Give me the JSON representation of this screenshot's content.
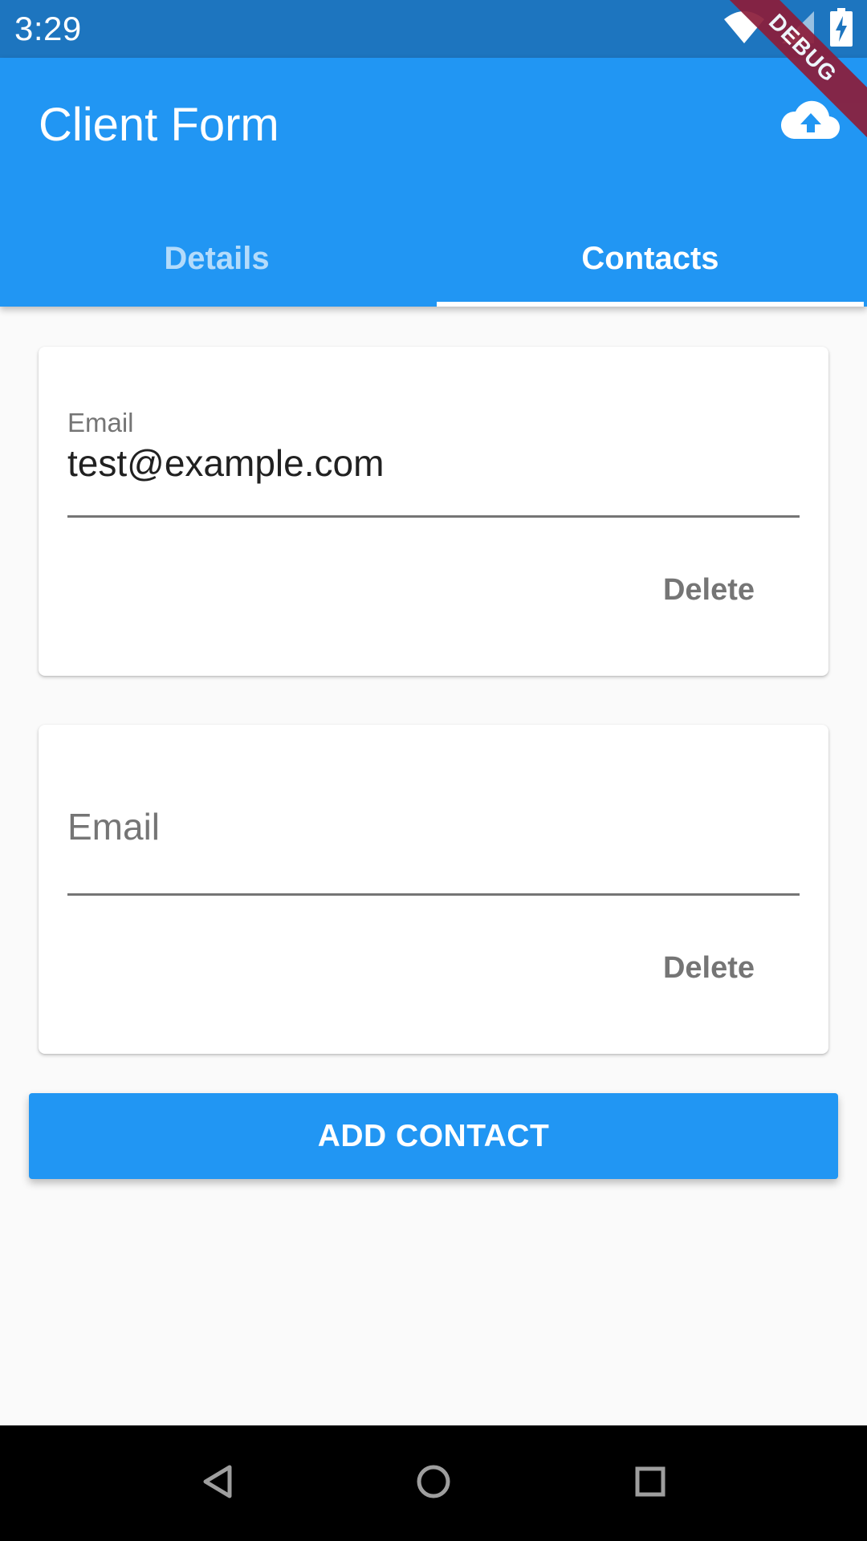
{
  "status_bar": {
    "time": "3:29",
    "icons": [
      "wifi-icon",
      "signal-icon",
      "battery-charging-icon"
    ]
  },
  "debug_banner": "DEBUG",
  "app_bar": {
    "title": "Client Form",
    "action_icon": "cloud-upload-icon"
  },
  "tabs": [
    {
      "label": "Details",
      "active": false
    },
    {
      "label": "Contacts",
      "active": true
    }
  ],
  "contacts": [
    {
      "field_label": "Email",
      "value": "test@example.com",
      "delete_label": "Delete"
    },
    {
      "field_label": "Email",
      "value": "",
      "delete_label": "Delete"
    }
  ],
  "add_contact_label": "ADD CONTACT",
  "nav_bar": {
    "icons": [
      "back-icon",
      "home-icon",
      "recent-apps-icon"
    ]
  },
  "colors": {
    "primary": "#2196f3",
    "status_bar": "#1d75bf",
    "inactive_tab": "#b3dbfb",
    "debug_ribbon": "#8c1d3a"
  }
}
